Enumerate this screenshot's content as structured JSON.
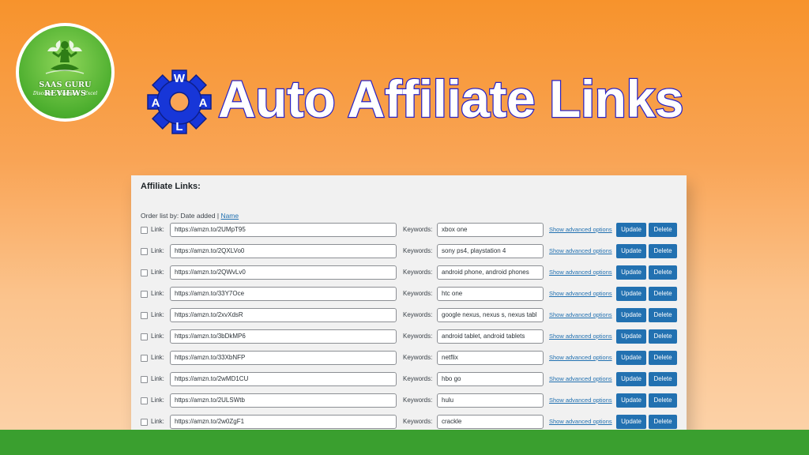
{
  "logo": {
    "title": "SAAS GURU REVIEWS",
    "tagline": "Discover . Evaluate . Excel"
  },
  "brand_icon": {
    "name": "gear-icon",
    "letters": {
      "top": "W",
      "left": "A",
      "right": "A",
      "bottom": "L"
    },
    "color": "#1736d8"
  },
  "headline": "Auto Affiliate Links",
  "panel": {
    "title": "Affiliate Links:",
    "order_prefix": "Order list by: Date added | ",
    "order_link": "Name",
    "link_label": "Link:",
    "keywords_label": "Keywords:",
    "advanced_label": "Show advanced options",
    "update_label": "Update",
    "delete_label": "Delete",
    "rows": [
      {
        "link": "https://amzn.to/2UMpT95",
        "keywords": "xbox one"
      },
      {
        "link": "https://amzn.to/2QXLVo0",
        "keywords": "sony ps4, playstation 4"
      },
      {
        "link": "https://amzn.to/2QWvLv0",
        "keywords": "android phone, android phones"
      },
      {
        "link": "https://amzn.to/33Y7Oce",
        "keywords": "htc one"
      },
      {
        "link": "https://amzn.to/2xvXdsR",
        "keywords": "google nexus, nexus s, nexus tabl"
      },
      {
        "link": "https://amzn.to/3bDkMP6",
        "keywords": "android tablet, android tablets"
      },
      {
        "link": "https://amzn.to/33XbNFP",
        "keywords": "netflix"
      },
      {
        "link": "https://amzn.to/2wMD1CU",
        "keywords": "hbo go"
      },
      {
        "link": "https://amzn.to/2ULSWtb",
        "keywords": "hulu"
      },
      {
        "link": "https://amzn.to/2w0ZgF1",
        "keywords": "crackle"
      }
    ]
  },
  "colors": {
    "accent_blue": "#2271b1",
    "band_green": "#3a9f2f",
    "background_orange": "#f7932c"
  }
}
